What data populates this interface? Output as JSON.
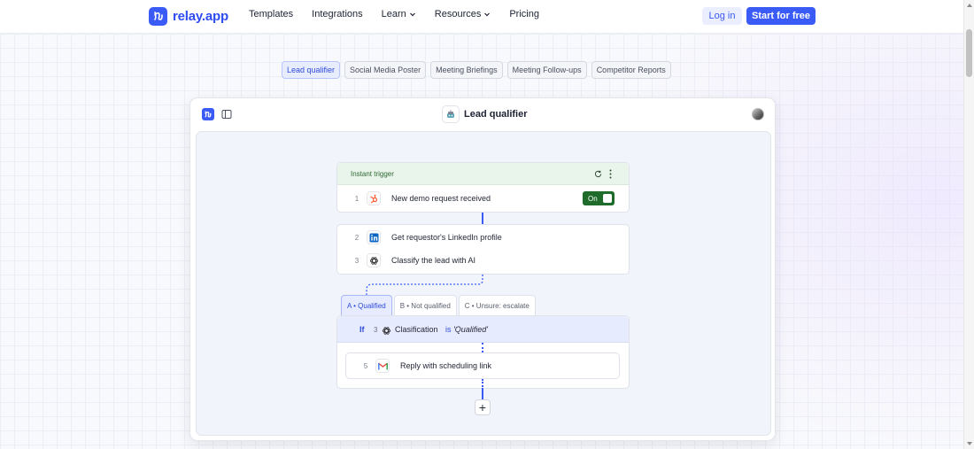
{
  "header": {
    "logo_text": "relay.app",
    "nav": [
      {
        "label": "Templates",
        "has_dropdown": false
      },
      {
        "label": "Integrations",
        "has_dropdown": false
      },
      {
        "label": "Learn",
        "has_dropdown": true
      },
      {
        "label": "Resources",
        "has_dropdown": true
      },
      {
        "label": "Pricing",
        "has_dropdown": false
      }
    ],
    "login_label": "Log in",
    "start_label": "Start for free"
  },
  "template_tabs": [
    {
      "label": "Lead qualifier",
      "active": true
    },
    {
      "label": "Social Media Poster",
      "active": false
    },
    {
      "label": "Meeting Briefings",
      "active": false
    },
    {
      "label": "Meeting Follow-ups",
      "active": false
    },
    {
      "label": "Competitor Reports",
      "active": false
    }
  ],
  "window": {
    "title": "Lead qualifier"
  },
  "workflow": {
    "trigger_label": "Instant trigger",
    "toggle_label": "On",
    "steps": [
      {
        "num": "1",
        "label": "New demo request received",
        "icon": "hubspot-icon"
      },
      {
        "num": "2",
        "label": "Get requestor's LinkedIn profile",
        "icon": "linkedin-icon"
      },
      {
        "num": "3",
        "label": "Classify the lead with AI",
        "icon": "openai-icon"
      }
    ],
    "branch_tabs": [
      {
        "label": "A • Qualified",
        "active": true
      },
      {
        "label": "B • Not qualified",
        "active": false
      },
      {
        "label": "C • Unsure: escalate",
        "active": false
      }
    ],
    "condition": {
      "if_label": "If",
      "step_num": "3",
      "field": "Clasification",
      "operator": "is",
      "value": "'Qualified'"
    },
    "branch_step": {
      "num": "5",
      "label": "Reply with scheduling link",
      "icon": "gmail-icon"
    },
    "add_label": "+"
  },
  "colors": {
    "brand": "#3b5bf6",
    "toggle_on": "#1f6b2a",
    "trigger_bg": "#e9f4ea"
  }
}
